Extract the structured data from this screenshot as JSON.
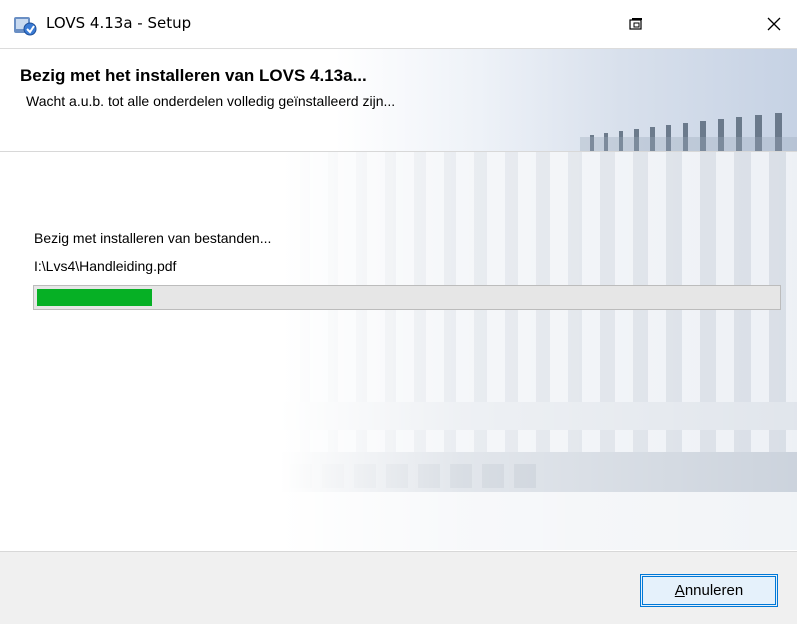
{
  "window": {
    "title": "LOVS 4.13a - Setup"
  },
  "header": {
    "title": "Bezig met het installeren van LOVS 4.13a...",
    "subtitle": "Wacht a.u.b. tot alle onderdelen volledig geïnstalleerd zijn..."
  },
  "main": {
    "status": "Bezig met installeren van bestanden...",
    "current_file": "I:\\Lvs4\\Handleiding.pdf",
    "progress_fraction": 0.155,
    "progress_color": "#06b025"
  },
  "footer": {
    "cancel_mnemonic": "A",
    "cancel_rest": "nnuleren"
  },
  "icons": {
    "app": "setup-installer-icon",
    "restore": "restore-window-icon",
    "close": "close-icon"
  }
}
